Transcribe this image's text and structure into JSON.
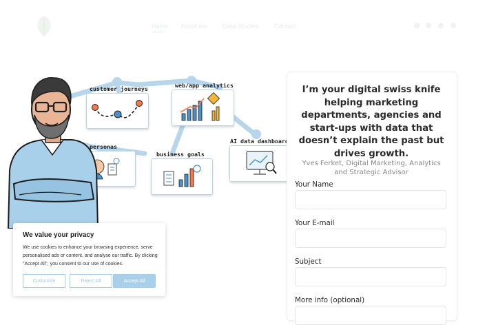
{
  "header": {
    "logo_icon": "leaf-logo-icon",
    "nav": [
      "Home",
      "About me",
      "Case Studies",
      "Contact"
    ],
    "right_icons": [
      "linkedin-icon",
      "mail-icon",
      "globe-icon",
      "menu-icon"
    ]
  },
  "illustration": {
    "labels": {
      "customer_journeys": "customer journeys",
      "web_app_analytics": "web/app analytics",
      "personas": "personas",
      "business_goals": "business goals",
      "ai_dashboards": "AI data dashboards"
    },
    "colors": {
      "connector": "#b7d6ec",
      "accent_orange": "#f07a4a",
      "accent_blue": "#4a92c8"
    }
  },
  "form": {
    "headline": "I’m your digital swiss knife helping marketing departments, agencies and start-ups with data that doesn’t explain the past but drives growth.",
    "byline": "Yves Ferket, Digital Marketing, Analytics and Strategic Advisor",
    "fields": {
      "name_label": "Your Name",
      "email_label": "Your E-mail",
      "subject_label": "Subject",
      "more_label": "More info (optional)"
    }
  },
  "cookie": {
    "title": "We value your privacy",
    "text": "We use cookies to enhance your browsing experience, serve personalised ads or content, and analyse our traffic. By clicking \"Accept All\", you consent to our use of cookies.",
    "customise": "Customise",
    "reject": "Reject All",
    "accept": "Accept All",
    "accent": "#a9d0ea"
  }
}
